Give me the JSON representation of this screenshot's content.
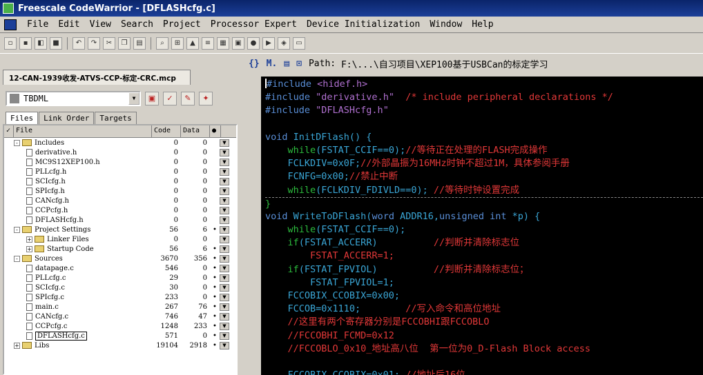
{
  "window": {
    "title": "Freescale CodeWarrior - [DFLASHcfg.c]"
  },
  "menu": [
    "File",
    "Edit",
    "View",
    "Search",
    "Project",
    "Processor Expert",
    "Device Initialization",
    "Window",
    "Help"
  ],
  "project": {
    "tab_label": "12-CAN-1939收发-ATVS-CCP-标定-CRC.mcp",
    "target": "TBDML",
    "subtabs": [
      "Files",
      "Link Order",
      "Targets"
    ],
    "columns": {
      "file": "File",
      "code": "Code",
      "data": "Data"
    },
    "rows": [
      {
        "indent": 0,
        "kind": "folder",
        "exp": "-",
        "name": "Includes",
        "code": "0",
        "data": "0",
        "dot": ""
      },
      {
        "indent": 1,
        "kind": "file",
        "name": "derivative.h",
        "code": "0",
        "data": "0",
        "dot": ""
      },
      {
        "indent": 1,
        "kind": "file",
        "name": "MC9S12XEP100.h",
        "code": "0",
        "data": "0",
        "dot": ""
      },
      {
        "indent": 1,
        "kind": "file",
        "name": "PLLcfg.h",
        "code": "0",
        "data": "0",
        "dot": ""
      },
      {
        "indent": 1,
        "kind": "file",
        "name": "SCIcfg.h",
        "code": "0",
        "data": "0",
        "dot": ""
      },
      {
        "indent": 1,
        "kind": "file",
        "name": "SPIcfg.h",
        "code": "0",
        "data": "0",
        "dot": ""
      },
      {
        "indent": 1,
        "kind": "file",
        "name": "CANcfg.h",
        "code": "0",
        "data": "0",
        "dot": ""
      },
      {
        "indent": 1,
        "kind": "file",
        "name": "CCPcfg.h",
        "code": "0",
        "data": "0",
        "dot": ""
      },
      {
        "indent": 1,
        "kind": "file",
        "name": "DFLASHcfg.h",
        "code": "0",
        "data": "0",
        "dot": ""
      },
      {
        "indent": 0,
        "kind": "folder",
        "exp": "-",
        "name": "Project Settings",
        "code": "56",
        "data": "6",
        "dot": "•"
      },
      {
        "indent": 1,
        "kind": "folder",
        "exp": "+",
        "name": "Linker Files",
        "code": "0",
        "data": "0",
        "dot": ""
      },
      {
        "indent": 1,
        "kind": "folder",
        "exp": "+",
        "name": "Startup Code",
        "code": "56",
        "data": "6",
        "dot": "•"
      },
      {
        "indent": 0,
        "kind": "folder",
        "exp": "-",
        "name": "Sources",
        "code": "3670",
        "data": "356",
        "dot": "•"
      },
      {
        "indent": 1,
        "kind": "file",
        "name": "datapage.c",
        "code": "546",
        "data": "0",
        "dot": "•"
      },
      {
        "indent": 1,
        "kind": "file",
        "name": "PLLcfg.c",
        "code": "29",
        "data": "0",
        "dot": "•"
      },
      {
        "indent": 1,
        "kind": "file",
        "name": "SCIcfg.c",
        "code": "30",
        "data": "0",
        "dot": "•"
      },
      {
        "indent": 1,
        "kind": "file",
        "name": "SPIcfg.c",
        "code": "233",
        "data": "0",
        "dot": "•"
      },
      {
        "indent": 1,
        "kind": "file",
        "name": "main.c",
        "code": "267",
        "data": "76",
        "dot": "•"
      },
      {
        "indent": 1,
        "kind": "file",
        "name": "CANcfg.c",
        "code": "746",
        "data": "47",
        "dot": "•"
      },
      {
        "indent": 1,
        "kind": "file",
        "name": "CCPcfg.c",
        "code": "1248",
        "data": "233",
        "dot": "•"
      },
      {
        "indent": 1,
        "kind": "file",
        "name": "DFLASHcfg.c",
        "code": "571",
        "data": "0",
        "dot": "•",
        "selected": true
      },
      {
        "indent": 0,
        "kind": "folder",
        "exp": "+",
        "name": "Libs",
        "code": "19104",
        "data": "2918",
        "dot": "•"
      }
    ]
  },
  "editor": {
    "path_label": "Path:",
    "path_value": "F:\\...\\自习项目\\XEP100基于USBCan的标定学习",
    "lines": [
      [
        [
          "#include ",
          "k"
        ],
        [
          "<hidef.h>",
          "s"
        ]
      ],
      [
        [
          "#include ",
          "k"
        ],
        [
          "\"derivative.h\"",
          "s"
        ],
        [
          "  /* include peripheral declarations */",
          "c"
        ]
      ],
      [
        [
          "#include ",
          "k"
        ],
        [
          "\"DFLASHcfg.h\"",
          "s"
        ]
      ],
      [
        [
          "",
          ""
        ]
      ],
      [
        [
          "void ",
          "k"
        ],
        [
          "InitDFlash() {",
          "t"
        ]
      ],
      [
        [
          "    while",
          "p"
        ],
        [
          "(FSTAT_CCIF==0);",
          "t"
        ],
        [
          "//等待正在处理的FLASH完成操作",
          "c"
        ]
      ],
      [
        [
          "    FCLKDIV=0x0F;",
          "t"
        ],
        [
          "//外部晶振为16MHz时钟不超过1M，具体参阅手册",
          "c"
        ]
      ],
      [
        [
          "    FCNFG=0x00;",
          "t"
        ],
        [
          "//禁止中断",
          "c"
        ]
      ],
      [
        [
          "    while",
          "p"
        ],
        [
          "(FCLKDIV_FDIVLD==0);",
          "t"
        ],
        [
          " //等待时钟设置完成",
          "c"
        ]
      ],
      [
        [
          "}",
          "p"
        ]
      ],
      [
        [
          "void ",
          "k"
        ],
        [
          "WriteToDFlash(",
          "t"
        ],
        [
          "word ",
          "k"
        ],
        [
          "ADDR16,",
          "t"
        ],
        [
          "unsigned int ",
          "k"
        ],
        [
          "*p) {",
          "t"
        ]
      ],
      [
        [
          "    while",
          "p"
        ],
        [
          "(FSTAT_CCIF==0);",
          "t"
        ]
      ],
      [
        [
          "    if",
          "p"
        ],
        [
          "(FSTAT_ACCERR)",
          "t"
        ],
        [
          "          //判断并清除标志位",
          "c"
        ]
      ],
      [
        [
          "        FSTAT_ACCERR=1;",
          "c"
        ]
      ],
      [
        [
          "    if",
          "p"
        ],
        [
          "(FSTAT_FPVIOL)",
          "t"
        ],
        [
          "          //判断并清除标志位；",
          "c"
        ]
      ],
      [
        [
          "        FSTAT_FPVIOL=1;",
          "t"
        ]
      ],
      [
        [
          "    FCCOBIX_CCOBIX=0x00;",
          "t"
        ]
      ],
      [
        [
          "    FCCOB=0x1110;",
          "t"
        ],
        [
          "        //写入命令和高位地址",
          "c"
        ]
      ],
      [
        [
          "    //这里有两个寄存器分别是FCCOBHI跟FCCOBLO",
          "c"
        ]
      ],
      [
        [
          "    //FCCOBHI_FCMD=0x12",
          "c"
        ]
      ],
      [
        [
          "    //FCCOBLO_0x10_地址高八位  第一位为0_D-Flash Block access",
          "c"
        ]
      ],
      [
        [
          "",
          ""
        ]
      ],
      [
        [
          "    FCCOBIX_CCOBIX=0x01;",
          "t"
        ],
        [
          " //地址后16位",
          "c"
        ]
      ]
    ]
  }
}
